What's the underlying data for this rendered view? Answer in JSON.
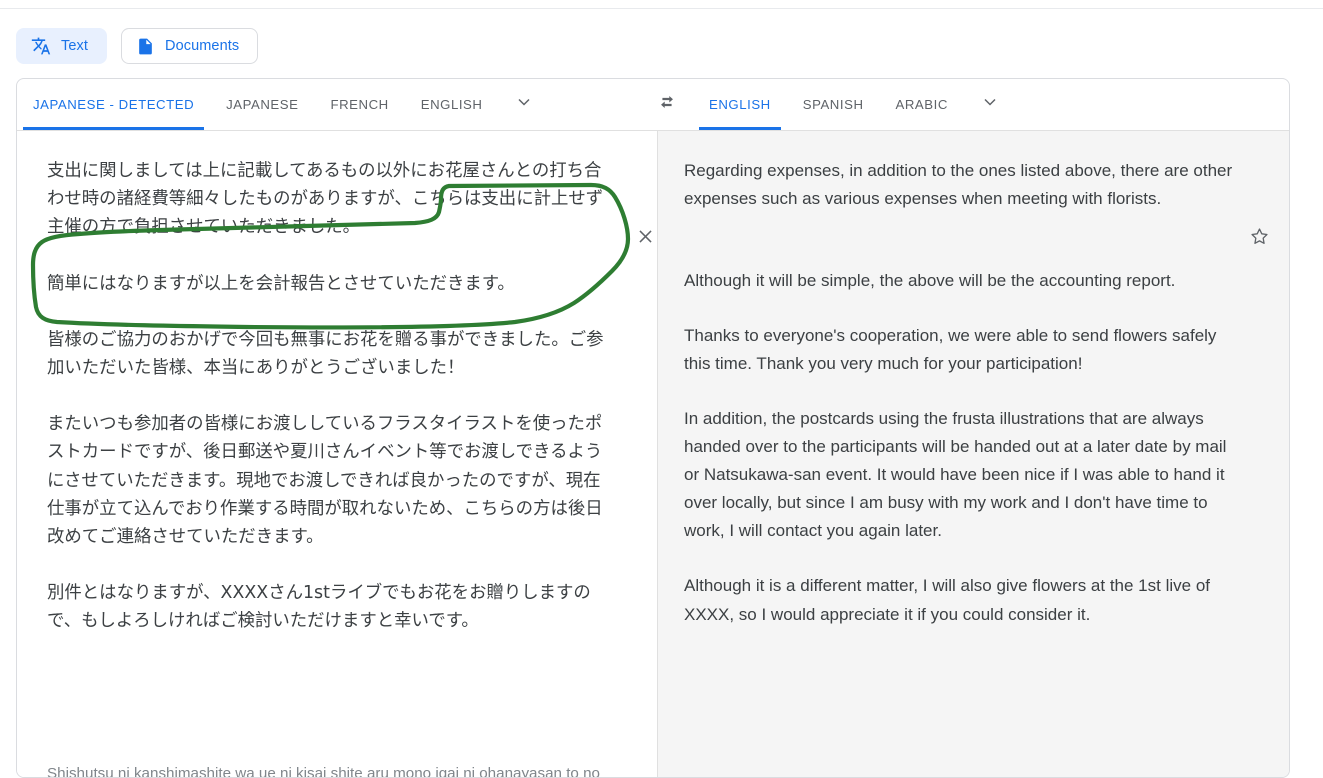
{
  "app": {
    "modes": [
      {
        "label": "Text",
        "icon": "translate-icon",
        "active": true
      },
      {
        "label": "Documents",
        "icon": "document-icon",
        "active": false
      }
    ]
  },
  "source_languages": {
    "tabs": [
      {
        "label": "JAPANESE - DETECTED",
        "active": true
      },
      {
        "label": "JAPANESE",
        "active": false
      },
      {
        "label": "FRENCH",
        "active": false
      },
      {
        "label": "ENGLISH",
        "active": false
      }
    ],
    "more_icon": "chevron-down-icon"
  },
  "swap": {
    "icon": "swap-languages-icon"
  },
  "target_languages": {
    "tabs": [
      {
        "label": "ENGLISH",
        "active": true
      },
      {
        "label": "SPANISH",
        "active": false
      },
      {
        "label": "ARABIC",
        "active": false
      }
    ],
    "more_icon": "chevron-down-icon"
  },
  "source_pane": {
    "clear_icon": "close-icon",
    "paragraphs": [
      "支出に関しましては上に記載してあるもの以外にお花屋さんとの打ち合わせ時の諸経費等細々したものがありますが、こちらは支出に計上せず主催の方で負担させていただきました。",
      "簡単にはなりますが以上を会計報告とさせていただきます。",
      "皆様のご協力のおかげで今回も無事にお花を贈る事ができました。ご参加いただいた皆様、本当にありがとうございました！",
      "またいつも参加者の皆様にお渡ししているフラスタイラストを使ったポストカードですが、後日郵送や夏川さんイベント等でお渡しできるようにさせていただきます。現地でお渡しできれば良かったのですが、現在仕事が立て込んでおり作業する時間が取れないため、こちらの方は後日改めてご連絡させていただきます。",
      "別件とはなりますが、XXXXさん1stライブでもお花をお贈りしますので、もしよろしければご検討いただけますと幸いです。"
    ],
    "romanization": "Shishutsu ni kanshimashite wa ue ni kisai shite aru mono igai ni ohanayasan to no",
    "annotation": {
      "type": "hand-drawn-circle",
      "color": "#2e7d32",
      "encloses": "こちらは支出に計上せず主催の方で負担させていただきました。"
    }
  },
  "target_pane": {
    "favorite_icon": "star-outline-icon",
    "paragraphs": [
      "Regarding expenses, in addition to the ones listed above, there are other expenses such as various expenses when meeting with florists.",
      "Although it will be simple, the above will be the accounting report.",
      "Thanks to everyone's cooperation, we were able to send flowers safely this time. Thank you very much for your participation!",
      "In addition, the postcards using the frusta illustrations that are always handed over to the participants will be handed out at a later date by mail or Natsukawa-san event. It would have been nice if I was able to hand it over locally, but since I am busy with my work and I don't have time to work, I will contact you again later.",
      "Although it is a different matter, I will also give flowers at the 1st live of XXXX, so I would appreciate it if you could consider it."
    ]
  },
  "colors": {
    "accent": "#1a73e8",
    "chip_active_bg": "#e8f0fe",
    "target_pane_bg": "#f5f5f5",
    "text": "#3c4043",
    "muted": "#5f6368",
    "annotation_green": "#2e7d32",
    "border": "#dadce0"
  }
}
